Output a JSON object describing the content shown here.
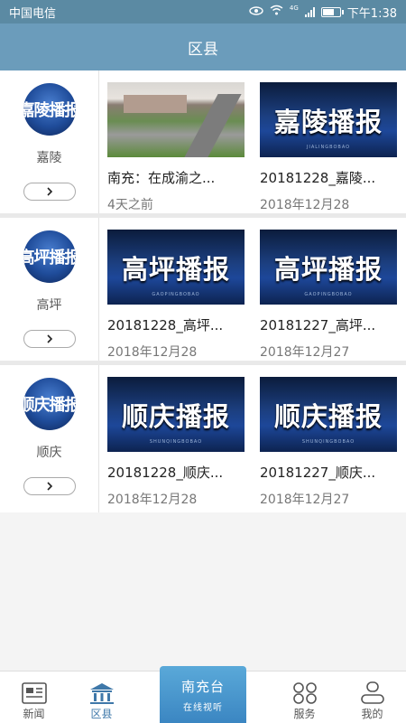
{
  "status_bar": {
    "carrier": "中国电信",
    "network": "4G",
    "battery_level": 0.7,
    "time": "下午1:38"
  },
  "header": {
    "title": "区县"
  },
  "regions": [
    {
      "avatar_text": "嘉陵播报",
      "name": "嘉陵",
      "more_icon": "chevron-right-icon",
      "items": [
        {
          "thumb_type": "photo",
          "title": "南充：在成渝之...",
          "meta": "4天之前"
        },
        {
          "thumb_type": "broadcast",
          "thumb_text": "嘉陵播报",
          "thumb_sub": "JIALINGBOBAO",
          "title": "20181228_嘉陵...",
          "meta": "2018年12月28"
        }
      ]
    },
    {
      "avatar_text": "高坪播报",
      "name": "高坪",
      "more_icon": "chevron-right-icon",
      "items": [
        {
          "thumb_type": "broadcast",
          "thumb_text": "高坪播报",
          "thumb_sub": "GAOPINGBOBAO",
          "title": "20181228_高坪...",
          "meta": "2018年12月28"
        },
        {
          "thumb_type": "broadcast",
          "thumb_text": "高坪播报",
          "thumb_sub": "GAOPINGBOBAO",
          "title": "20181227_高坪...",
          "meta": "2018年12月27"
        }
      ]
    },
    {
      "avatar_text": "顺庆播报",
      "name": "顺庆",
      "more_icon": "chevron-right-icon",
      "items": [
        {
          "thumb_type": "broadcast",
          "thumb_text": "顺庆播报",
          "thumb_sub": "SHUNQINGBOBAO",
          "title": "20181228_顺庆...",
          "meta": "2018年12月28"
        },
        {
          "thumb_type": "broadcast",
          "thumb_text": "顺庆播报",
          "thumb_sub": "SHUNQINGBOBAO",
          "title": "20181227_顺庆...",
          "meta": "2018年12月27"
        }
      ]
    }
  ],
  "bottom_nav": {
    "news": {
      "label": "新闻",
      "icon": "newspaper-icon"
    },
    "district": {
      "label": "区县",
      "icon": "building-icon",
      "active": true
    },
    "center": {
      "label": "南充台",
      "sub": "在线视听"
    },
    "service": {
      "label": "服务",
      "icon": "grid-icon"
    },
    "mine": {
      "label": "我的",
      "icon": "user-icon"
    }
  },
  "colors": {
    "title_bar": "#6b9cbb",
    "status_bar": "#5b8aa3",
    "accent": "#3f78a9",
    "center_button": "#3b86c2"
  }
}
